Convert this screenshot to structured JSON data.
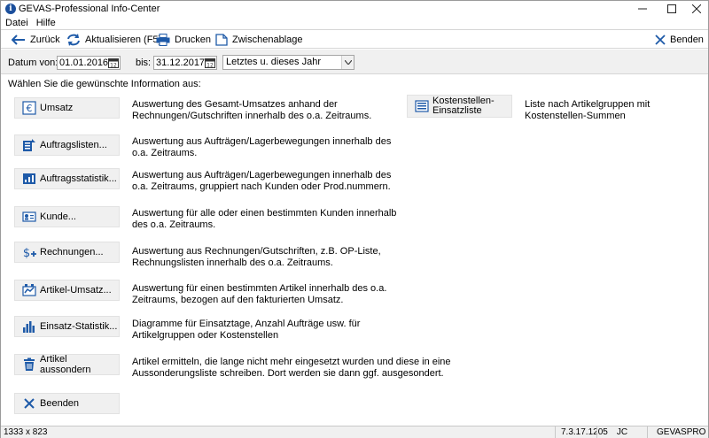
{
  "window": {
    "title": "GEVAS-Professional Info-Center",
    "controls": {
      "minimize": "—",
      "maximize": "☐",
      "close": "✕"
    }
  },
  "menu": {
    "items": [
      "Datei",
      "Hilfe"
    ]
  },
  "toolbar": {
    "back": "Zurück",
    "refresh": "Aktualisieren (F5)",
    "print": "Drucken",
    "clipboard": "Zwischenablage",
    "exit": "Benden"
  },
  "filter": {
    "from_label": "Datum von:",
    "from_value": "01.01.2016",
    "to_label": "bis:",
    "to_value": "31.12.2017",
    "range_value": "Letztes u. dieses Jahr"
  },
  "content": {
    "prompt": "Wählen Sie die gewünschte Information aus:",
    "options": [
      {
        "label": "Umsatz",
        "icon": "euro-icon",
        "desc": "Auswertung des Gesamt-Umsatzes anhand der\nRechnungen/Gutschriften innerhalb des o.a. Zeitraums."
      },
      {
        "label": "Auftragslisten...",
        "icon": "order-list-icon",
        "desc": "Auswertung aus Aufträgen/Lagerbewegungen innerhalb des\no.a. Zeitraums."
      },
      {
        "label": "Auftragsstatistik...",
        "icon": "order-stats-icon",
        "desc": "Auswertung aus Aufträgen/Lagerbewegungen innerhalb des\no.a. Zeitraums, gruppiert nach Kunden oder Prod.nummern."
      },
      {
        "label": "Kunde...",
        "icon": "customer-card-icon",
        "desc": "Auswertung für alle oder einen bestimmten Kunden innerhalb\ndes o.a. Zeitraums."
      },
      {
        "label": "Rechnungen...",
        "icon": "invoice-dollar-icon",
        "desc": "Auswertung aus Rechnungen/Gutschriften, z.B. OP-Liste,\nRechnungslisten innerhalb des o.a. Zeitraums."
      },
      {
        "label": "Artikel-Umsatz...",
        "icon": "article-sales-icon",
        "desc": "Auswertung für einen bestimmten Artikel innerhalb des o.a.\nZeitraums, bezogen auf den fakturierten Umsatz."
      },
      {
        "label": "Einsatz-Statistik...",
        "icon": "bar-chart-icon",
        "desc": "Diagramme für Einsatztage, Anzahl Aufträge usw. für\nArtikelgruppen oder  Kostenstellen"
      },
      {
        "label": "Artikel aussondern",
        "icon": "trash-icon",
        "desc": "Artikel ermitteln, die lange nicht mehr eingesetzt wurden und diese in eine\nAussonderungsliste schreiben. Dort werden sie dann ggf. ausgesondert."
      },
      {
        "label": "Beenden",
        "icon": "close-icon",
        "desc": ""
      }
    ],
    "cost_center": {
      "label": "Kostenstellen-\nEinsatzliste",
      "desc": "Liste nach Artikelgruppen mit Kostenstellen-Summen"
    }
  },
  "status": {
    "dimensions": "1333 x 823",
    "version": "7.3.17.1205",
    "user": "JC",
    "app": "GEVASPRO"
  }
}
